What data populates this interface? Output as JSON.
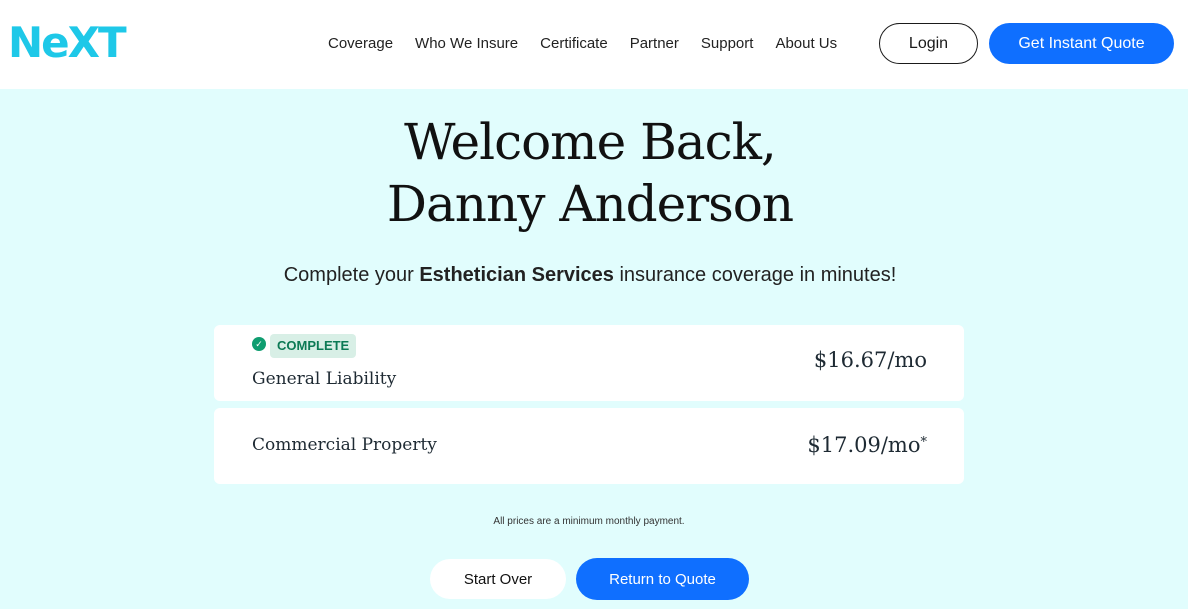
{
  "header": {
    "logo": "NeXT",
    "nav": [
      {
        "label": "Coverage"
      },
      {
        "label": "Who We Insure"
      },
      {
        "label": "Certificate"
      },
      {
        "label": "Partner"
      },
      {
        "label": "Support"
      },
      {
        "label": "About Us"
      }
    ],
    "login_label": "Login",
    "quote_label": "Get Instant Quote"
  },
  "main": {
    "title_line1": "Welcome Back,",
    "title_line2": "Danny Anderson",
    "subtitle_pre": "Complete your ",
    "subtitle_bold": "Esthetician Services",
    "subtitle_post": " insurance coverage in minutes!",
    "coverages": [
      {
        "status": "COMPLETE",
        "name": "General Liability",
        "price": "$16.67/mo",
        "asterisk": ""
      },
      {
        "status": "",
        "name": "Commercial Property",
        "price": "$17.09/mo",
        "asterisk": "*"
      }
    ],
    "note": "All prices are a minimum monthly payment.",
    "start_over_label": "Start Over",
    "return_label": "Return to Quote"
  },
  "colors": {
    "brand_cyan": "#1ec8e8",
    "primary_blue": "#0f6fff",
    "background_mint": "#e1fdfd",
    "complete_green": "#0f9d70"
  }
}
